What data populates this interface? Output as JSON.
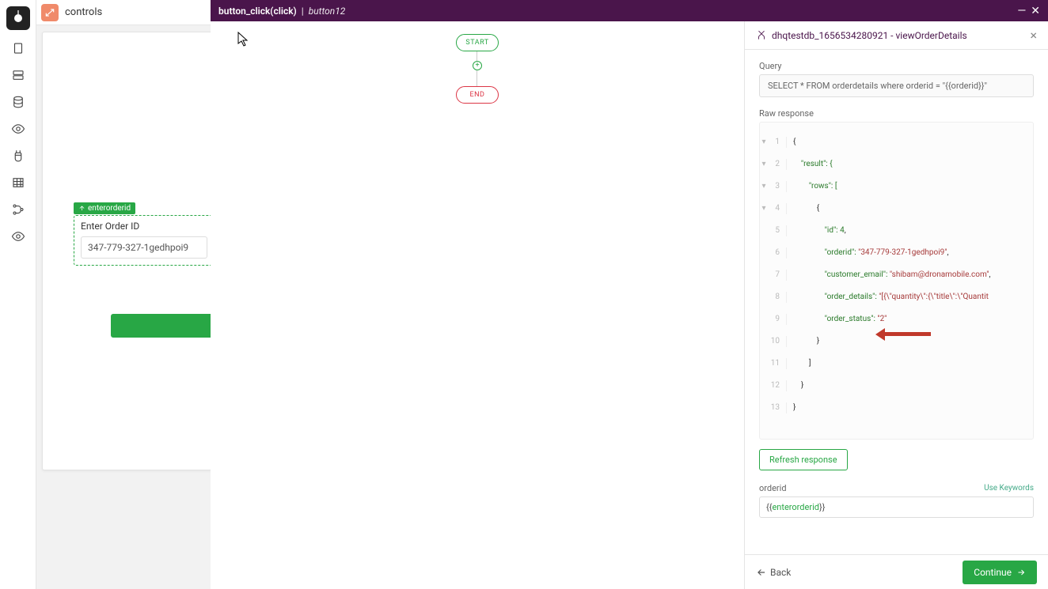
{
  "topbar": {
    "title": "controls"
  },
  "canvas": {
    "widget_tag": "enterorderid",
    "widget_label": "Enter Order ID",
    "widget_value": "347-779-327-1gedhpoi9"
  },
  "panel_header": {
    "event": "button_click(click)",
    "target": "button12"
  },
  "flow": {
    "start": "START",
    "end": "END",
    "add": "+"
  },
  "right": {
    "title": "dhqtestdb_1656534280921 - viewOrderDetails",
    "query_label": "Query",
    "query_value": "SELECT * FROM orderdetails where orderid = \"{{orderid}}\"",
    "raw_label": "Raw response",
    "code": {
      "l1": "{",
      "l2": "    \"result\": {",
      "l3": "        \"rows\": [",
      "l4": "            {",
      "l5a": "                \"id\": ",
      "l5b": "4",
      "l5c": ",",
      "l6a": "                \"orderid\": ",
      "l6b": "\"347-779-327-1gedhpoi9\"",
      "l6c": ",",
      "l7a": "                \"customer_email\": ",
      "l7b": "\"shibam@dronamobile.com\"",
      "l7c": ",",
      "l8a": "                \"order_details\": ",
      "l8b": "\"[{\\\"quantity\\\":{\\\"title\\\":\\\"Quantit",
      "l9a": "                \"order_status\": ",
      "l9b": "\"2\"",
      "l10": "            }",
      "l11": "        ]",
      "l12": "    }",
      "l13": "}"
    },
    "refresh": "Refresh response",
    "param_name": "orderid",
    "use_keywords": "Use Keywords",
    "param_prefix": "{{",
    "param_var": "enterorderid",
    "param_suffix": "}}"
  },
  "footer": {
    "back": "Back",
    "continue": "Continue"
  }
}
